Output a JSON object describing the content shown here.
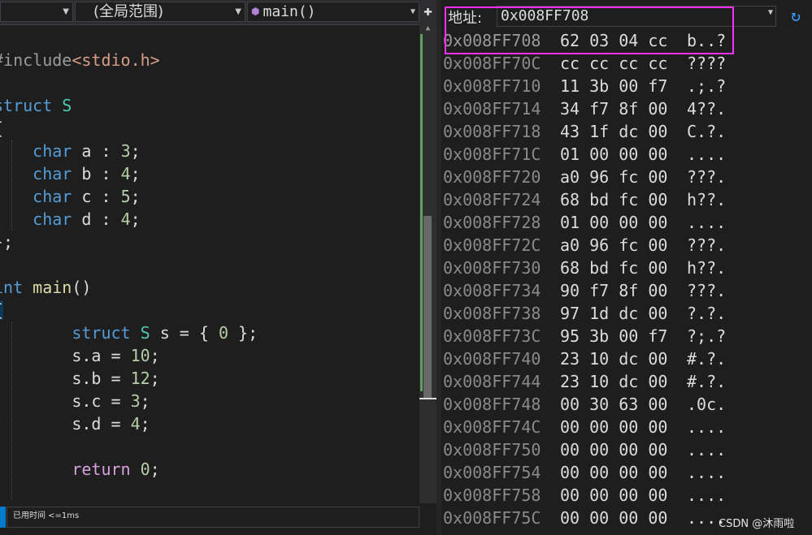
{
  "editor": {
    "nav": {
      "scope": "(全局范围)",
      "function": "main()"
    },
    "code_lines": [
      {
        "parts": [
          {
            "t": "#include",
            "c": "pp"
          },
          {
            "t": "<stdio.h>",
            "c": "inc"
          }
        ]
      },
      {
        "parts": []
      },
      {
        "parts": [
          {
            "t": "struct",
            "c": "kw"
          },
          {
            "t": " "
          },
          {
            "t": "S",
            "c": "ty"
          }
        ]
      },
      {
        "parts": [
          {
            "t": "{"
          }
        ]
      },
      {
        "parts": [
          {
            "t": "    "
          },
          {
            "t": "char",
            "c": "kw"
          },
          {
            "t": " a : "
          },
          {
            "t": "3",
            "c": "nm"
          },
          {
            "t": ";"
          }
        ]
      },
      {
        "parts": [
          {
            "t": "    "
          },
          {
            "t": "char",
            "c": "kw"
          },
          {
            "t": " b : "
          },
          {
            "t": "4",
            "c": "nm"
          },
          {
            "t": ";"
          }
        ]
      },
      {
        "parts": [
          {
            "t": "    "
          },
          {
            "t": "char",
            "c": "kw"
          },
          {
            "t": " c : "
          },
          {
            "t": "5",
            "c": "nm"
          },
          {
            "t": ";"
          }
        ]
      },
      {
        "parts": [
          {
            "t": "    "
          },
          {
            "t": "char",
            "c": "kw"
          },
          {
            "t": " d : "
          },
          {
            "t": "4",
            "c": "nm"
          },
          {
            "t": ";"
          }
        ]
      },
      {
        "parts": [
          {
            "t": "};"
          }
        ]
      },
      {
        "parts": []
      },
      {
        "parts": [
          {
            "t": "int",
            "c": "kw"
          },
          {
            "t": " "
          },
          {
            "t": "main",
            "c": "fn"
          },
          {
            "t": "()"
          }
        ]
      },
      {
        "parts": [
          {
            "t": "{",
            "c": "brace-hl"
          }
        ]
      },
      {
        "parts": [
          {
            "t": "        "
          },
          {
            "t": "struct",
            "c": "kw"
          },
          {
            "t": " "
          },
          {
            "t": "S",
            "c": "ty"
          },
          {
            "t": " s = { "
          },
          {
            "t": "0",
            "c": "nm"
          },
          {
            "t": " };"
          }
        ]
      },
      {
        "parts": [
          {
            "t": "        s.a = "
          },
          {
            "t": "10",
            "c": "nm"
          },
          {
            "t": ";"
          }
        ]
      },
      {
        "parts": [
          {
            "t": "        s.b = "
          },
          {
            "t": "12",
            "c": "nm"
          },
          {
            "t": ";"
          }
        ]
      },
      {
        "parts": [
          {
            "t": "        s.c = "
          },
          {
            "t": "3",
            "c": "nm"
          },
          {
            "t": ";"
          }
        ]
      },
      {
        "parts": [
          {
            "t": "        s.d = "
          },
          {
            "t": "4",
            "c": "nm"
          },
          {
            "t": ";"
          }
        ]
      },
      {
        "parts": []
      },
      {
        "parts": [
          {
            "t": "        "
          },
          {
            "t": "return",
            "c": "ctl"
          },
          {
            "t": " "
          },
          {
            "t": "0",
            "c": "nm"
          },
          {
            "t": ";"
          }
        ]
      }
    ],
    "status_text": "已用时间 <=1ms",
    "split_icon": "plus-icon"
  },
  "memory": {
    "address_label": "地址:",
    "address_value": "0x008FF708",
    "refresh_icon": "refresh-icon",
    "highlight_color": "#ff30ff",
    "rows": [
      {
        "addr": "0x008FF708",
        "hex": "62 03 04 cc",
        "ascii": "b..?"
      },
      {
        "addr": "0x008FF70C",
        "hex": "cc cc cc cc",
        "ascii": "????"
      },
      {
        "addr": "0x008FF710",
        "hex": "11 3b 00 f7",
        "ascii": ".;.?"
      },
      {
        "addr": "0x008FF714",
        "hex": "34 f7 8f 00",
        "ascii": "4??."
      },
      {
        "addr": "0x008FF718",
        "hex": "43 1f dc 00",
        "ascii": "C.?."
      },
      {
        "addr": "0x008FF71C",
        "hex": "01 00 00 00",
        "ascii": "...."
      },
      {
        "addr": "0x008FF720",
        "hex": "a0 96 fc 00",
        "ascii": "???."
      },
      {
        "addr": "0x008FF724",
        "hex": "68 bd fc 00",
        "ascii": "h??."
      },
      {
        "addr": "0x008FF728",
        "hex": "01 00 00 00",
        "ascii": "...."
      },
      {
        "addr": "0x008FF72C",
        "hex": "a0 96 fc 00",
        "ascii": "???."
      },
      {
        "addr": "0x008FF730",
        "hex": "68 bd fc 00",
        "ascii": "h??."
      },
      {
        "addr": "0x008FF734",
        "hex": "90 f7 8f 00",
        "ascii": "???."
      },
      {
        "addr": "0x008FF738",
        "hex": "97 1d dc 00",
        "ascii": "?.?."
      },
      {
        "addr": "0x008FF73C",
        "hex": "95 3b 00 f7",
        "ascii": "?;.?"
      },
      {
        "addr": "0x008FF740",
        "hex": "23 10 dc 00",
        "ascii": "#.?."
      },
      {
        "addr": "0x008FF744",
        "hex": "23 10 dc 00",
        "ascii": "#.?."
      },
      {
        "addr": "0x008FF748",
        "hex": "00 30 63 00",
        "ascii": ".0c."
      },
      {
        "addr": "0x008FF74C",
        "hex": "00 00 00 00",
        "ascii": "...."
      },
      {
        "addr": "0x008FF750",
        "hex": "00 00 00 00",
        "ascii": "...."
      },
      {
        "addr": "0x008FF754",
        "hex": "00 00 00 00",
        "ascii": "...."
      },
      {
        "addr": "0x008FF758",
        "hex": "00 00 00 00",
        "ascii": "...."
      },
      {
        "addr": "0x008FF75C",
        "hex": "00 00 00 00",
        "ascii": "...."
      }
    ]
  },
  "watermark": "CSDN @沐雨啦"
}
